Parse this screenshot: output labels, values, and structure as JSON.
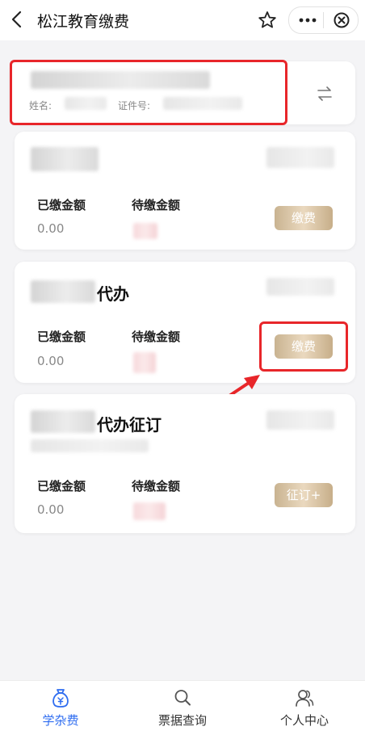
{
  "header": {
    "title": "松江教育缴费"
  },
  "account": {
    "name_label": "姓名:",
    "id_label": "证件号:"
  },
  "cards": [
    {
      "heading_suffix": "",
      "paid_label": "已缴金额",
      "pending_label": "待缴金额",
      "paid_amount": "0.00",
      "button": "缴费"
    },
    {
      "heading_suffix": "代办",
      "paid_label": "已缴金额",
      "pending_label": "待缴金额",
      "paid_amount": "0.00",
      "button": "缴费"
    },
    {
      "heading_suffix": "代办征订",
      "paid_label": "已缴金额",
      "pending_label": "待缴金额",
      "paid_amount": "0.00",
      "button": "征订+"
    }
  ],
  "tabs": [
    {
      "label": "学杂费",
      "icon": "fee-bag-icon",
      "active": true
    },
    {
      "label": "票据查询",
      "icon": "search-icon",
      "active": false
    },
    {
      "label": "个人中心",
      "icon": "user-icon",
      "active": false
    }
  ],
  "colors": {
    "active_tab": "#2f6df0",
    "highlight": "#e8262a",
    "button_gold": "#d6c2a2"
  }
}
